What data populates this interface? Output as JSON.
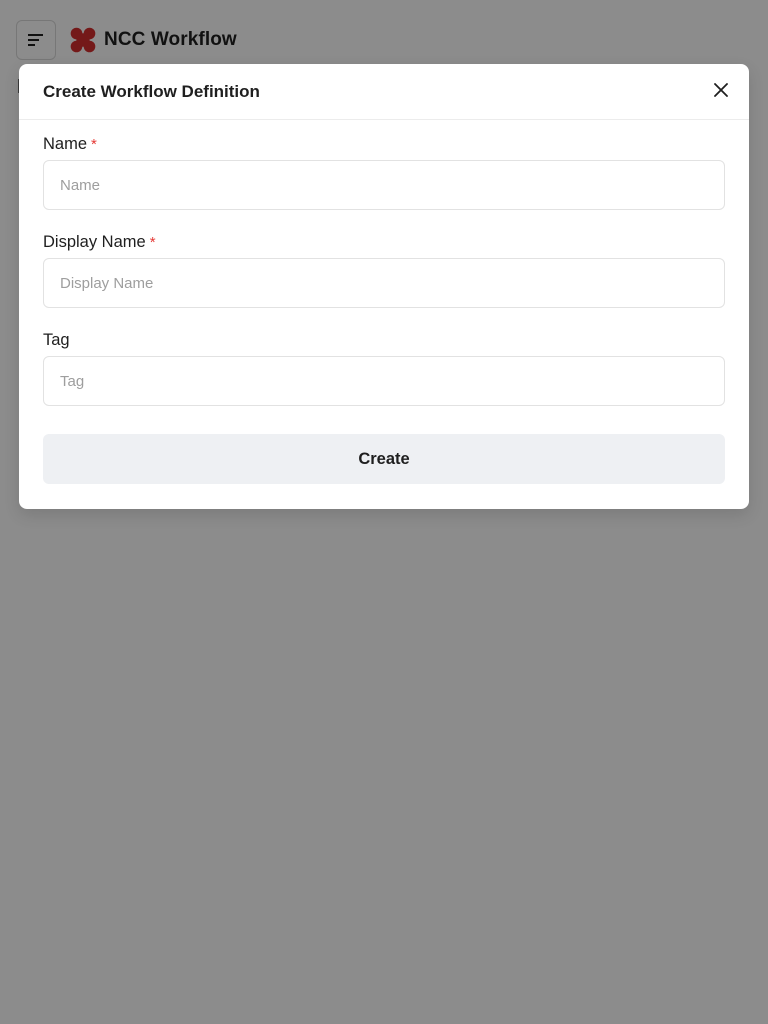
{
  "app": {
    "brand_name": "NCC Workflow",
    "brand_color": "#d32f2f",
    "menu_icon": "hamburger-menu-icon",
    "logo_icon": "ncc-logo-icon",
    "bg_heading_fragment": "I"
  },
  "modal": {
    "title": "Create Workflow Definition",
    "close_icon": "close-icon",
    "fields": [
      {
        "label": "Name",
        "required": true,
        "required_mark": "*",
        "placeholder": "Name",
        "value": ""
      },
      {
        "label": "Display Name",
        "required": true,
        "required_mark": "*",
        "placeholder": "Display Name",
        "value": ""
      },
      {
        "label": "Tag",
        "required": false,
        "required_mark": "",
        "placeholder": "Tag",
        "value": ""
      }
    ],
    "submit_label": "Create"
  },
  "colors": {
    "overlay": "rgba(0,0,0,0.45)",
    "required": "#e53935",
    "button_bg": "#eef0f3"
  }
}
